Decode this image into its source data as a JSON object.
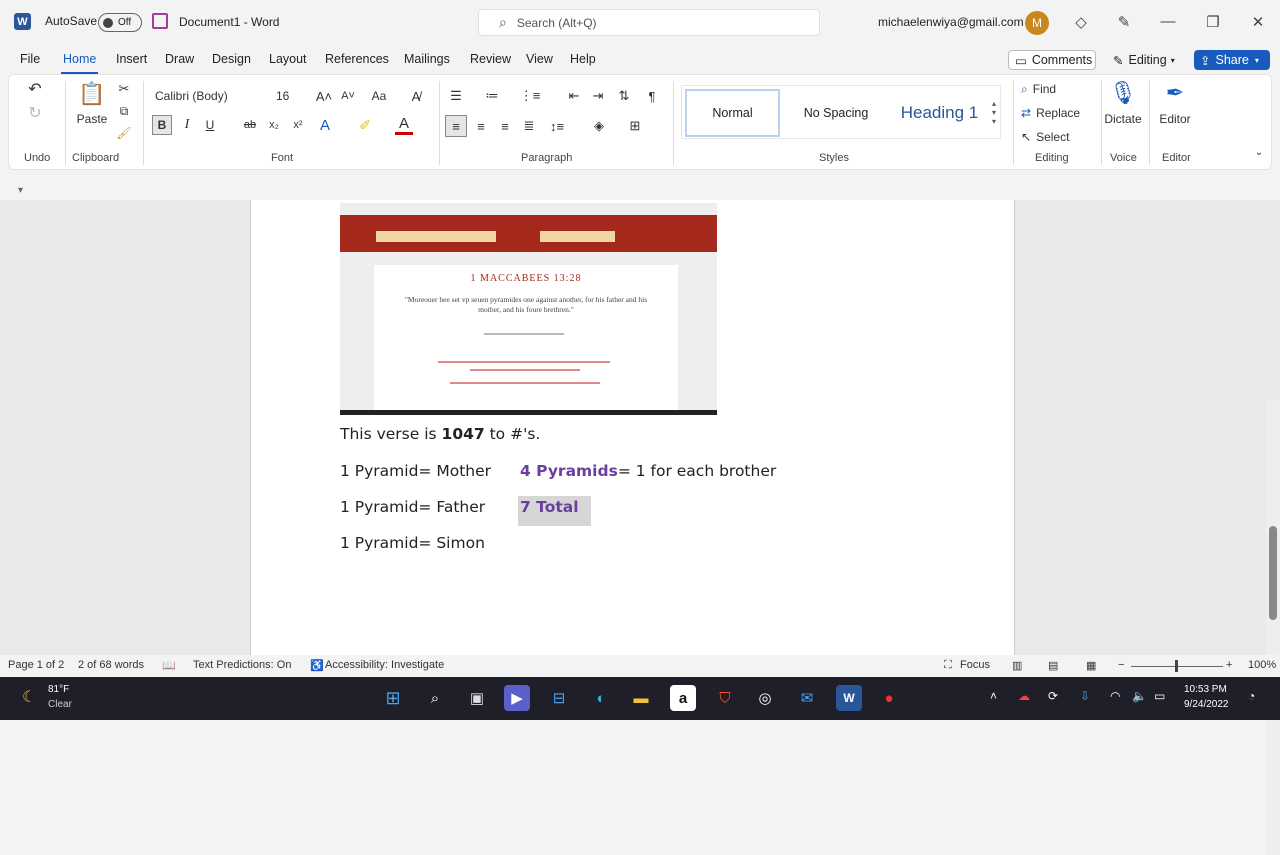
{
  "titlebar": {
    "autosave_label": "AutoSave",
    "autosave_state": "Off",
    "doc_title": "Document1  -  Word",
    "search_placeholder": "Search (Alt+Q)",
    "email": "michaelenwiya@gmail.com",
    "avatar_letter": "M"
  },
  "menu": {
    "items": [
      "File",
      "Home",
      "Insert",
      "Draw",
      "Design",
      "Layout",
      "References",
      "Mailings",
      "Review",
      "View",
      "Help"
    ],
    "comments": "Comments",
    "editing": "Editing",
    "share": "Share"
  },
  "ribbon": {
    "font_name": "Calibri (Body)",
    "font_size": "16",
    "paste": "Paste",
    "styles": [
      "Normal",
      "No Spacing",
      "Heading 1"
    ],
    "find": "Find",
    "replace": "Replace",
    "select": "Select",
    "dictate": "Dictate",
    "editor": "Editor",
    "groups": {
      "undo": "Undo",
      "clipboard": "Clipboard",
      "font": "Font",
      "paragraph": "Paragraph",
      "styles": "Styles",
      "editing": "Editing",
      "voice": "Voice",
      "editor": "Editor"
    }
  },
  "embedded_image": {
    "title": "1 MACCABEES 13:28",
    "verse": "\"Moreouer hee set vp seuen pyramides one against another, for his father and his mother, and his foure brethren.\""
  },
  "document": {
    "line1_pre": "This verse is ",
    "line1_bold": "1047",
    "line1_post": " to #'s.",
    "line2": "1 Pyramid= Mother",
    "line2b_bold": "4 Pyramids",
    "line2b_rest": "= 1 for each brother",
    "line3": "1 Pyramid= Father",
    "line3b": "7 Total",
    "line4": "1 Pyramid= Simon"
  },
  "statusbar": {
    "page": "Page 1 of 2",
    "words": "2 of 68 words",
    "predictions": "Text Predictions: On",
    "accessibility": "Accessibility: Investigate",
    "focus": "Focus",
    "zoom": "100%"
  },
  "taskbar": {
    "temp": "81°F",
    "weather": "Clear",
    "time": "10:53 PM",
    "date": "9/24/2022"
  },
  "colors": {
    "accent": "#185abd",
    "purple_text": "#6a3fa0",
    "embedded_header": "#a5281d"
  }
}
